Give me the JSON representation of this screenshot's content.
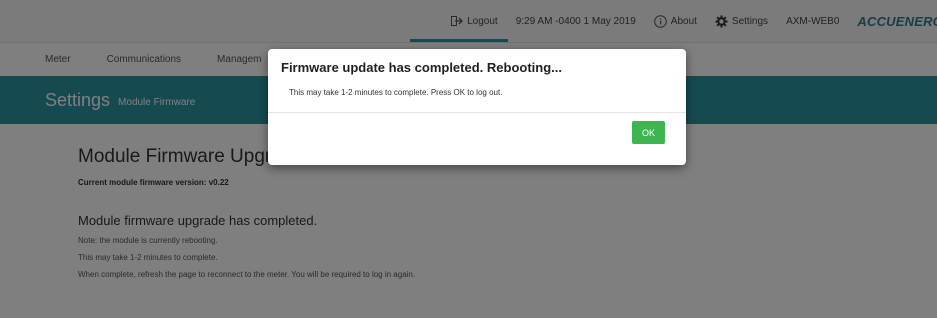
{
  "topbar": {
    "logout_label": "Logout",
    "datetime": "9:29 AM -0400 1 May 2019",
    "about_label": "About",
    "settings_label": "Settings",
    "device_name": "AXM-WEB0",
    "brand": "ACCUENERG"
  },
  "nav": {
    "items": [
      "Meter",
      "Communications",
      "Managem"
    ]
  },
  "settings_bar": {
    "title": "Settings",
    "subtitle": "Module Firmware"
  },
  "page": {
    "heading": "Module Firmware Upgrad",
    "version_line": "Current module firmware version: v0.22",
    "complete_heading": "Module firmware upgrade has completed.",
    "notes": [
      "Note: the module is currently rebooting.",
      "This may take 1-2 minutes to complete.",
      "When complete, refresh the page to reconnect to the meter. You will be required to log in again."
    ]
  },
  "modal": {
    "title": "Firmware update has completed. Rebooting...",
    "body": "This may take 1-2 minutes to complete. Press OK to log out.",
    "ok_label": "OK"
  },
  "colors": {
    "teal": "#2c94a2",
    "ok_green": "#3fb552",
    "brand": "#2b7f8b"
  }
}
